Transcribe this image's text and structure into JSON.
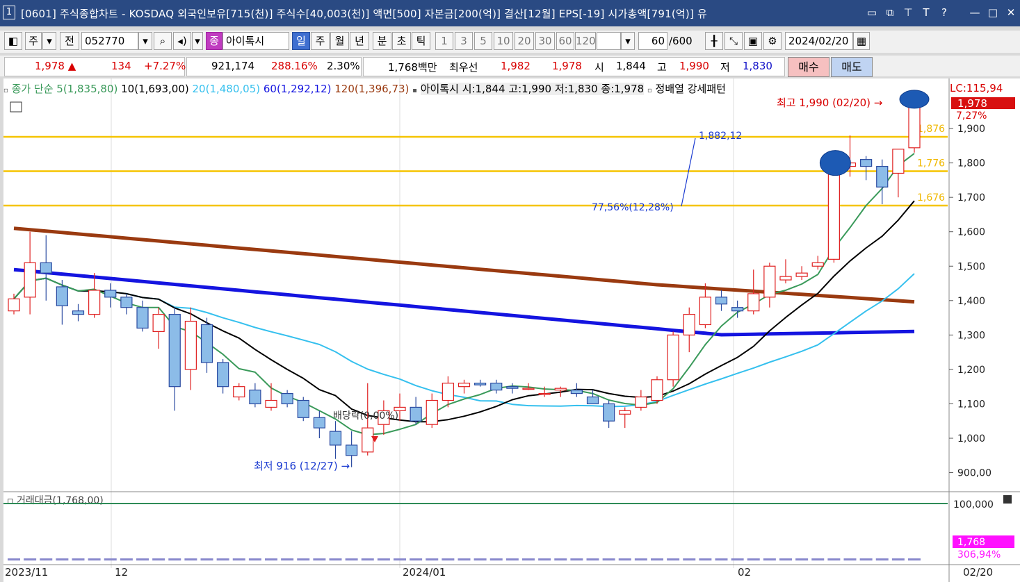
{
  "titlebar": {
    "window_num": "1",
    "title": "[0601] 주식종합차트 - KOSDAQ 외국인보유[715(천)] 주식수[40,003(천)] 액면[500] 자본금[200(억)] 결산[12월] EPS[-19] 시가총액[791(억)] 유",
    "icons": [
      "restore-icon",
      "tile-icon",
      "pin-icon",
      "text-icon",
      "help-icon",
      "minimize-icon",
      "maximize-icon",
      "close-icon"
    ]
  },
  "toolbar": {
    "market": "주",
    "prefix": "전",
    "code": "052770",
    "search_icon": "search-icon",
    "sound_icon": "speaker-icon",
    "badge": "종",
    "stock_name": "아이톡시",
    "periods": [
      "일",
      "주",
      "월",
      "년",
      "분",
      "초",
      "틱"
    ],
    "active_period": "일",
    "intervals": [
      "1",
      "3",
      "5",
      "10",
      "20",
      "30",
      "60",
      "120"
    ],
    "view_count": "60",
    "total_count": "/600",
    "date": "2024/02/20"
  },
  "quote": {
    "price": "1,978",
    "change": "134",
    "change_pct": "+7.27%",
    "volume": "921,174",
    "vol_ratio": "288.16%",
    "turnover": "2.30%",
    "amount": "1,768백만",
    "best_label": "최우선",
    "ask": "1,982",
    "bid": "1,978",
    "open_label": "시",
    "open": "1,844",
    "high_label": "고",
    "high": "1,990",
    "low_label": "저",
    "low": "1,830",
    "buy": "매수",
    "sell": "매도"
  },
  "legend": {
    "ma_label": "종가 단순 5(1,835,80)",
    "ma10": "10(1,693,00)",
    "ma20": "20(1,480,05)",
    "ma60": "60(1,292,12)",
    "ma120": "120(1,396,73)",
    "price_info": "아이톡시 시:1,844 고:1,990 저:1,830 종:1,978",
    "pattern": "정배열 강세패턴"
  },
  "annotations": {
    "high_note": "최고 1,990 (02/20)",
    "low_note": "최저 916 (12/27)",
    "fib_value": "1,882,12",
    "fib_pct": "77,56%(12,28%)",
    "dividend": "배당락(0,00%)",
    "level1": "1,876",
    "level2": "1,776",
    "level3": "1,676"
  },
  "axis": {
    "lc_label": "LC:115,94",
    "last_price": "1,978",
    "last_pct": "7,27%",
    "y_ticks": [
      "1,900",
      "1,800",
      "1,700",
      "1,600",
      "1,500",
      "1,400",
      "1,300",
      "1,200",
      "1,100",
      "1,000",
      "900,00"
    ],
    "x_ticks": [
      "2023/11",
      "12",
      "2024/01",
      "02",
      "02/20"
    ],
    "vol_label": "거래대금(1,768,00)",
    "vol_tick": "100,000",
    "vol_last": "1,768",
    "vol_pct": "306,94%"
  },
  "colors": {
    "up": "#e02020",
    "down": "#2a4aa0",
    "ma5": "#3a9a5a",
    "ma10": "#000000",
    "ma20": "#35c0ee",
    "ma60": "#1414e0",
    "ma120": "#9a3a10",
    "fib": "#f5c400"
  },
  "chart_data": {
    "type": "candlestick",
    "ylim": [
      850,
      2000
    ],
    "fib_levels": [
      1876,
      1776,
      1676
    ],
    "candles": [
      {
        "o": 1370,
        "h": 1420,
        "l": 1360,
        "c": 1405
      },
      {
        "o": 1410,
        "h": 1600,
        "l": 1360,
        "c": 1510
      },
      {
        "o": 1510,
        "h": 1590,
        "l": 1400,
        "c": 1480
      },
      {
        "o": 1440,
        "h": 1460,
        "l": 1330,
        "c": 1385
      },
      {
        "o": 1370,
        "h": 1390,
        "l": 1340,
        "c": 1360
      },
      {
        "o": 1360,
        "h": 1480,
        "l": 1350,
        "c": 1430
      },
      {
        "o": 1430,
        "h": 1450,
        "l": 1380,
        "c": 1410
      },
      {
        "o": 1410,
        "h": 1420,
        "l": 1360,
        "c": 1380
      },
      {
        "o": 1380,
        "h": 1400,
        "l": 1310,
        "c": 1320
      },
      {
        "o": 1310,
        "h": 1380,
        "l": 1260,
        "c": 1360
      },
      {
        "o": 1360,
        "h": 1380,
        "l": 1080,
        "c": 1150
      },
      {
        "o": 1200,
        "h": 1380,
        "l": 1140,
        "c": 1340
      },
      {
        "o": 1330,
        "h": 1350,
        "l": 1190,
        "c": 1220
      },
      {
        "o": 1220,
        "h": 1230,
        "l": 1130,
        "c": 1150
      },
      {
        "o": 1120,
        "h": 1160,
        "l": 1110,
        "c": 1150
      },
      {
        "o": 1140,
        "h": 1160,
        "l": 1090,
        "c": 1100
      },
      {
        "o": 1090,
        "h": 1160,
        "l": 1080,
        "c": 1110
      },
      {
        "o": 1130,
        "h": 1140,
        "l": 1090,
        "c": 1100
      },
      {
        "o": 1110,
        "h": 1120,
        "l": 1050,
        "c": 1060
      },
      {
        "o": 1060,
        "h": 1080,
        "l": 1000,
        "c": 1030
      },
      {
        "o": 1020,
        "h": 1050,
        "l": 940,
        "c": 980
      },
      {
        "o": 980,
        "h": 1020,
        "l": 916,
        "c": 950
      },
      {
        "o": 960,
        "h": 1160,
        "l": 950,
        "c": 1030
      },
      {
        "o": 1040,
        "h": 1110,
        "l": 1010,
        "c": 1080
      },
      {
        "o": 1080,
        "h": 1130,
        "l": 1050,
        "c": 1090
      },
      {
        "o": 1090,
        "h": 1120,
        "l": 1040,
        "c": 1050
      },
      {
        "o": 1040,
        "h": 1130,
        "l": 1030,
        "c": 1110
      },
      {
        "o": 1110,
        "h": 1180,
        "l": 1090,
        "c": 1160
      },
      {
        "o": 1150,
        "h": 1170,
        "l": 1130,
        "c": 1160
      },
      {
        "o": 1160,
        "h": 1170,
        "l": 1150,
        "c": 1155
      },
      {
        "o": 1160,
        "h": 1170,
        "l": 1130,
        "c": 1140
      },
      {
        "o": 1150,
        "h": 1160,
        "l": 1130,
        "c": 1145
      },
      {
        "o": 1145,
        "h": 1160,
        "l": 1140,
        "c": 1145
      },
      {
        "o": 1130,
        "h": 1150,
        "l": 1120,
        "c": 1130
      },
      {
        "o": 1140,
        "h": 1150,
        "l": 1120,
        "c": 1145
      },
      {
        "o": 1140,
        "h": 1160,
        "l": 1120,
        "c": 1130
      },
      {
        "o": 1120,
        "h": 1140,
        "l": 1110,
        "c": 1100
      },
      {
        "o": 1100,
        "h": 1110,
        "l": 1030,
        "c": 1050
      },
      {
        "o": 1070,
        "h": 1090,
        "l": 1030,
        "c": 1080
      },
      {
        "o": 1090,
        "h": 1140,
        "l": 1080,
        "c": 1120
      },
      {
        "o": 1110,
        "h": 1180,
        "l": 1100,
        "c": 1170
      },
      {
        "o": 1170,
        "h": 1310,
        "l": 1150,
        "c": 1300
      },
      {
        "o": 1300,
        "h": 1380,
        "l": 1250,
        "c": 1360
      },
      {
        "o": 1330,
        "h": 1450,
        "l": 1320,
        "c": 1410
      },
      {
        "o": 1410,
        "h": 1430,
        "l": 1370,
        "c": 1390
      },
      {
        "o": 1380,
        "h": 1400,
        "l": 1350,
        "c": 1370
      },
      {
        "o": 1370,
        "h": 1490,
        "l": 1360,
        "c": 1420
      },
      {
        "o": 1410,
        "h": 1510,
        "l": 1380,
        "c": 1500
      },
      {
        "o": 1460,
        "h": 1520,
        "l": 1450,
        "c": 1470
      },
      {
        "o": 1470,
        "h": 1500,
        "l": 1460,
        "c": 1480
      },
      {
        "o": 1500,
        "h": 1530,
        "l": 1490,
        "c": 1510
      },
      {
        "o": 1520,
        "h": 1800,
        "l": 1510,
        "c": 1800
      },
      {
        "o": 1790,
        "h": 1880,
        "l": 1760,
        "c": 1800
      },
      {
        "o": 1810,
        "h": 1820,
        "l": 1750,
        "c": 1790
      },
      {
        "o": 1790,
        "h": 1810,
        "l": 1680,
        "c": 1730
      },
      {
        "o": 1770,
        "h": 1800,
        "l": 1700,
        "c": 1840
      },
      {
        "o": 1844,
        "h": 1990,
        "l": 1830,
        "c": 1978
      }
    ]
  }
}
